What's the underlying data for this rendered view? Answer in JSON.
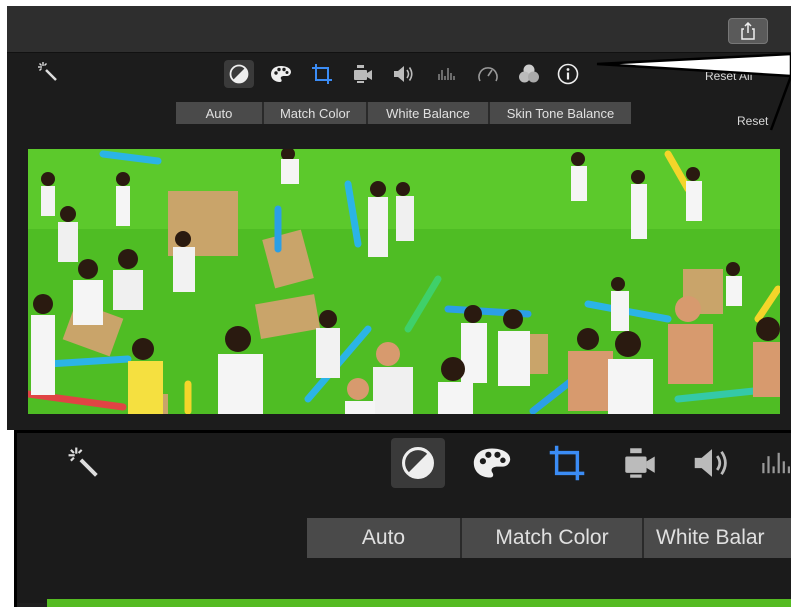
{
  "toolbar": {
    "buttons": {
      "auto": "Auto",
      "match_color": "Match Color",
      "white_balance": "White Balance",
      "skin_tone_balance": "Skin Tone Balance"
    },
    "reset_all": "Reset All",
    "reset": "Reset"
  },
  "zoom_toolbar": {
    "buttons": {
      "auto": "Auto",
      "match_color": "Match Color",
      "white_balance": "White Balar"
    }
  },
  "icons": [
    "magic-wand-icon",
    "color-balance-icon",
    "color-correction-palette-icon",
    "crop-icon",
    "stabilization-camera-icon",
    "volume-icon",
    "equalizer-icon",
    "speed-icon",
    "filter-icon",
    "info-icon",
    "share-icon"
  ],
  "colors": {
    "accent_blue": "#3b8cf5",
    "window_bg": "#1f1f1f",
    "segment_bg": "#4a4a4a"
  }
}
